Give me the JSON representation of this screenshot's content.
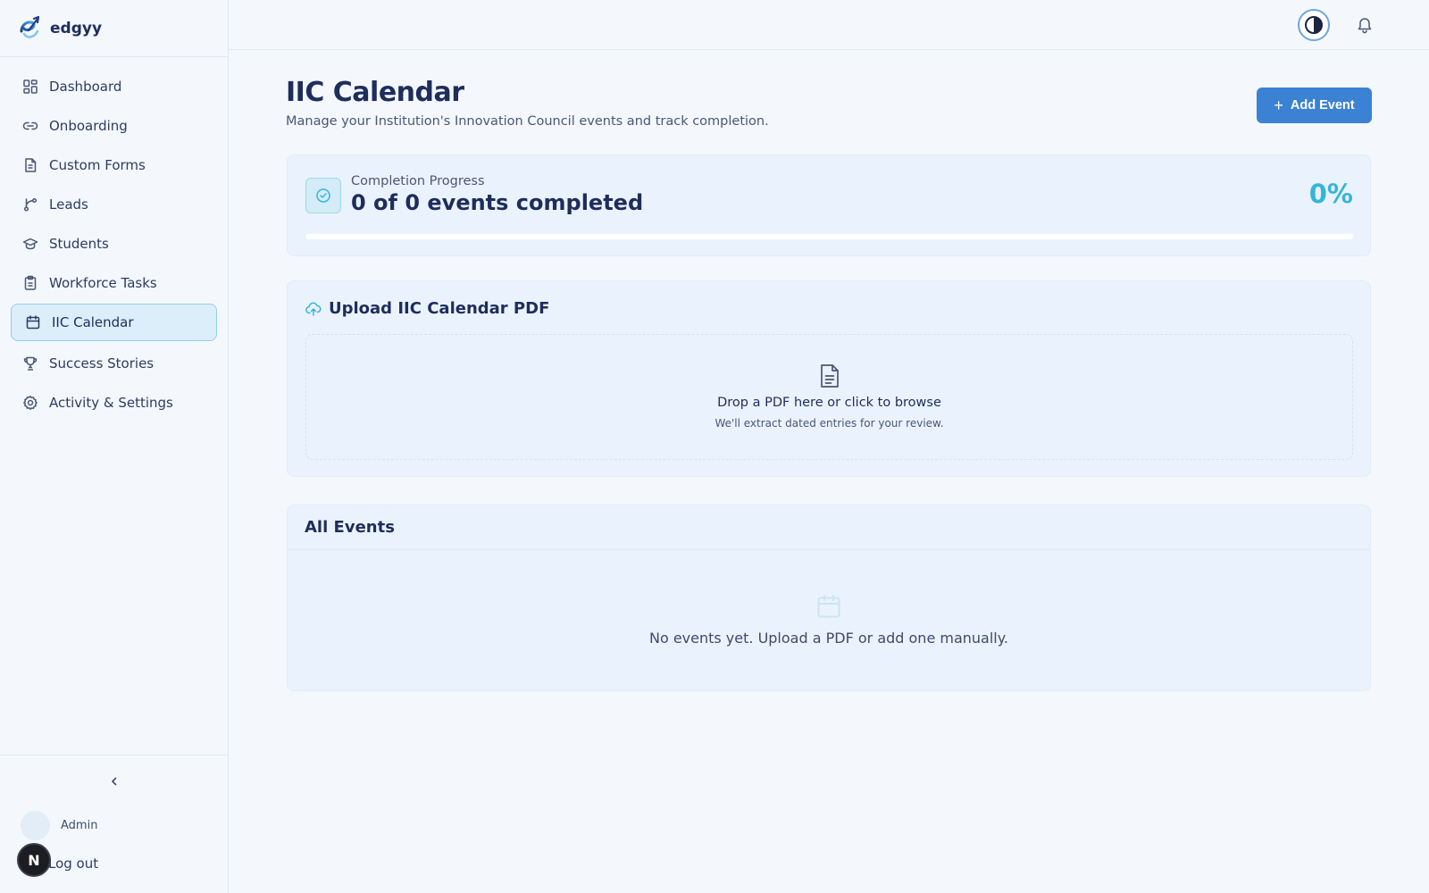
{
  "brand": {
    "name": "edgyy"
  },
  "sidebar": {
    "items": [
      {
        "label": "Dashboard",
        "icon": "dashboard-grid-icon"
      },
      {
        "label": "Onboarding",
        "icon": "link-icon"
      },
      {
        "label": "Custom Forms",
        "icon": "document-icon"
      },
      {
        "label": "Leads",
        "icon": "branch-icon"
      },
      {
        "label": "Students",
        "icon": "graduation-cap-icon"
      },
      {
        "label": "Workforce Tasks",
        "icon": "clipboard-icon"
      },
      {
        "label": "IIC Calendar",
        "icon": "calendar-icon",
        "active": true
      },
      {
        "label": "Success Stories",
        "icon": "trophy-icon"
      },
      {
        "label": "Activity & Settings",
        "icon": "gear-icon"
      }
    ],
    "collapse_icon": "chevron-left-icon",
    "user_name": "Admin",
    "logout_label": "Log out",
    "n_badge": "N"
  },
  "header": {
    "page_title": "IIC Calendar",
    "page_subtitle": "Manage your Institution's Innovation Council events and track completion.",
    "add_button": {
      "icon": "+",
      "label": "Add Event"
    }
  },
  "progress": {
    "label": "Completion Progress",
    "count_text": "0 of 0 events completed",
    "percent_text": "0%",
    "fraction": 0
  },
  "upload": {
    "title": "Upload IIC Calendar PDF",
    "drop_main": "Drop a PDF here or click to browse",
    "drop_sub": "We'll extract dated entries for your review."
  },
  "events": {
    "title": "All Events",
    "empty_text": "No events yet. Upload a PDF or add one manually."
  },
  "colors": {
    "accent": "#3b82d4",
    "progress": "#36b4dc",
    "active_nav_bg": "#dceefa",
    "active_nav_border": "#8fd0ea",
    "text_dark": "#1e2d5c"
  }
}
